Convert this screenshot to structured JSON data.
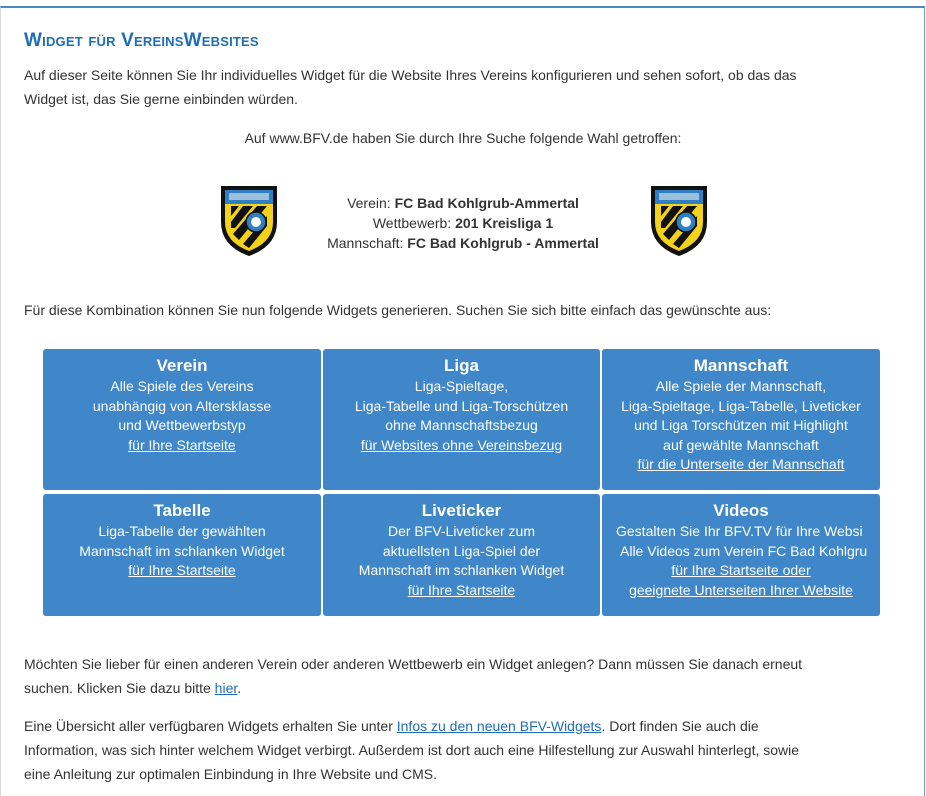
{
  "heading": "Widget für VereinsWebsites",
  "intro": "Auf dieser Seite können Sie Ihr individuelles Widget für die Website Ihres Vereins konfigurieren und sehen sofort, ob das das Widget ist, das Sie gerne einbinden würden.",
  "intro_line1": "Auf dieser Seite können Sie Ihr individuelles Widget für die Website Ihres Vereins konfigurieren und sehen sofort, ob das das",
  "intro_line2": "Widget ist, das Sie gerne einbinden würden.",
  "search_info": "Auf www.BFV.de haben Sie durch Ihre Suche folgende Wahl getroffen:",
  "selection": {
    "verein_label": "Verein: ",
    "verein_value": "FC Bad Kohlgrub-Ammertal",
    "wettbewerb_label": "Wettbewerb: ",
    "wettbewerb_value": "201 Kreisliga 1",
    "mannschaft_label": "Mannschaft: ",
    "mannschaft_value": "FC Bad Kohlgrub - Ammertal"
  },
  "crest_icon": "club-crest-icon",
  "combo_text": "Für diese Kombination können Sie nun folgende Widgets generieren. Suchen Sie sich bitte einfach das gewünschte aus:",
  "tiles": [
    {
      "title": "Verein",
      "lines": [
        "Alle Spiele des Vereins",
        "unabhängig von Altersklasse",
        "und Wettbewerbstyp"
      ],
      "link": "für Ihre Startseite"
    },
    {
      "title": "Liga",
      "lines": [
        "Liga-Spieltage,",
        "Liga-Tabelle und Liga-Torschützen",
        "ohne Mannschaftsbezug"
      ],
      "link": "für Websites ohne Vereinsbezug"
    },
    {
      "title": "Mannschaft",
      "lines": [
        "Alle Spiele der Mannschaft,",
        "Liga-Spieltage, Liga-Tabelle, Liveticker",
        "und Liga Torschützen mit Highlight",
        "auf gewählte Mannschaft"
      ],
      "link": "für die Unterseite der Mannschaft"
    },
    {
      "title": "Tabelle",
      "lines": [
        "Liga-Tabelle der gewählten",
        "Mannschaft im schlanken Widget"
      ],
      "link": "für Ihre Startseite"
    },
    {
      "title": "Liveticker",
      "lines": [
        "Der BFV-Liveticker zum",
        "aktuellsten Liga-Spiel der",
        "Mannschaft im schlanken Widget"
      ],
      "link": "für Ihre Startseite"
    },
    {
      "title": "Videos",
      "lines": [
        "Gestalten Sie Ihr BFV.TV für Ihre Websi",
        "Alle Videos zum Verein FC Bad Kohlgru"
      ],
      "link": "für Ihre Startseite oder",
      "link2": "geeignete Unterseiten Ihrer Website"
    }
  ],
  "other_text": {
    "line1": "Möchten Sie lieber für einen anderen Verein oder anderen Wettbewerb ein Widget anlegen? Dann müssen Sie danach erneut",
    "line2_before": "suchen. Klicken Sie dazu bitte ",
    "link": "hier",
    "line2_after": "."
  },
  "overview_text": {
    "line1_before": "Eine Übersicht aller verfügbaren Widgets erhalten Sie unter ",
    "link": "Infos zu den neuen BFV-Widgets",
    "line1_after": ". Dort finden Sie auch die",
    "line2": "Information, was sich hinter welchem Widget verbirgt. Außerdem ist dort auch eine Hilfestellung zur Auswahl hinterlegt, sowie",
    "line3": "eine Anleitung zur optimalen Einbindung in Ihre Website und CMS."
  },
  "colors": {
    "accent": "#1e6eb8",
    "tile": "#3f87c9",
    "crest_yellow": "#f2d21b",
    "crest_blue": "#2f7fc4"
  }
}
